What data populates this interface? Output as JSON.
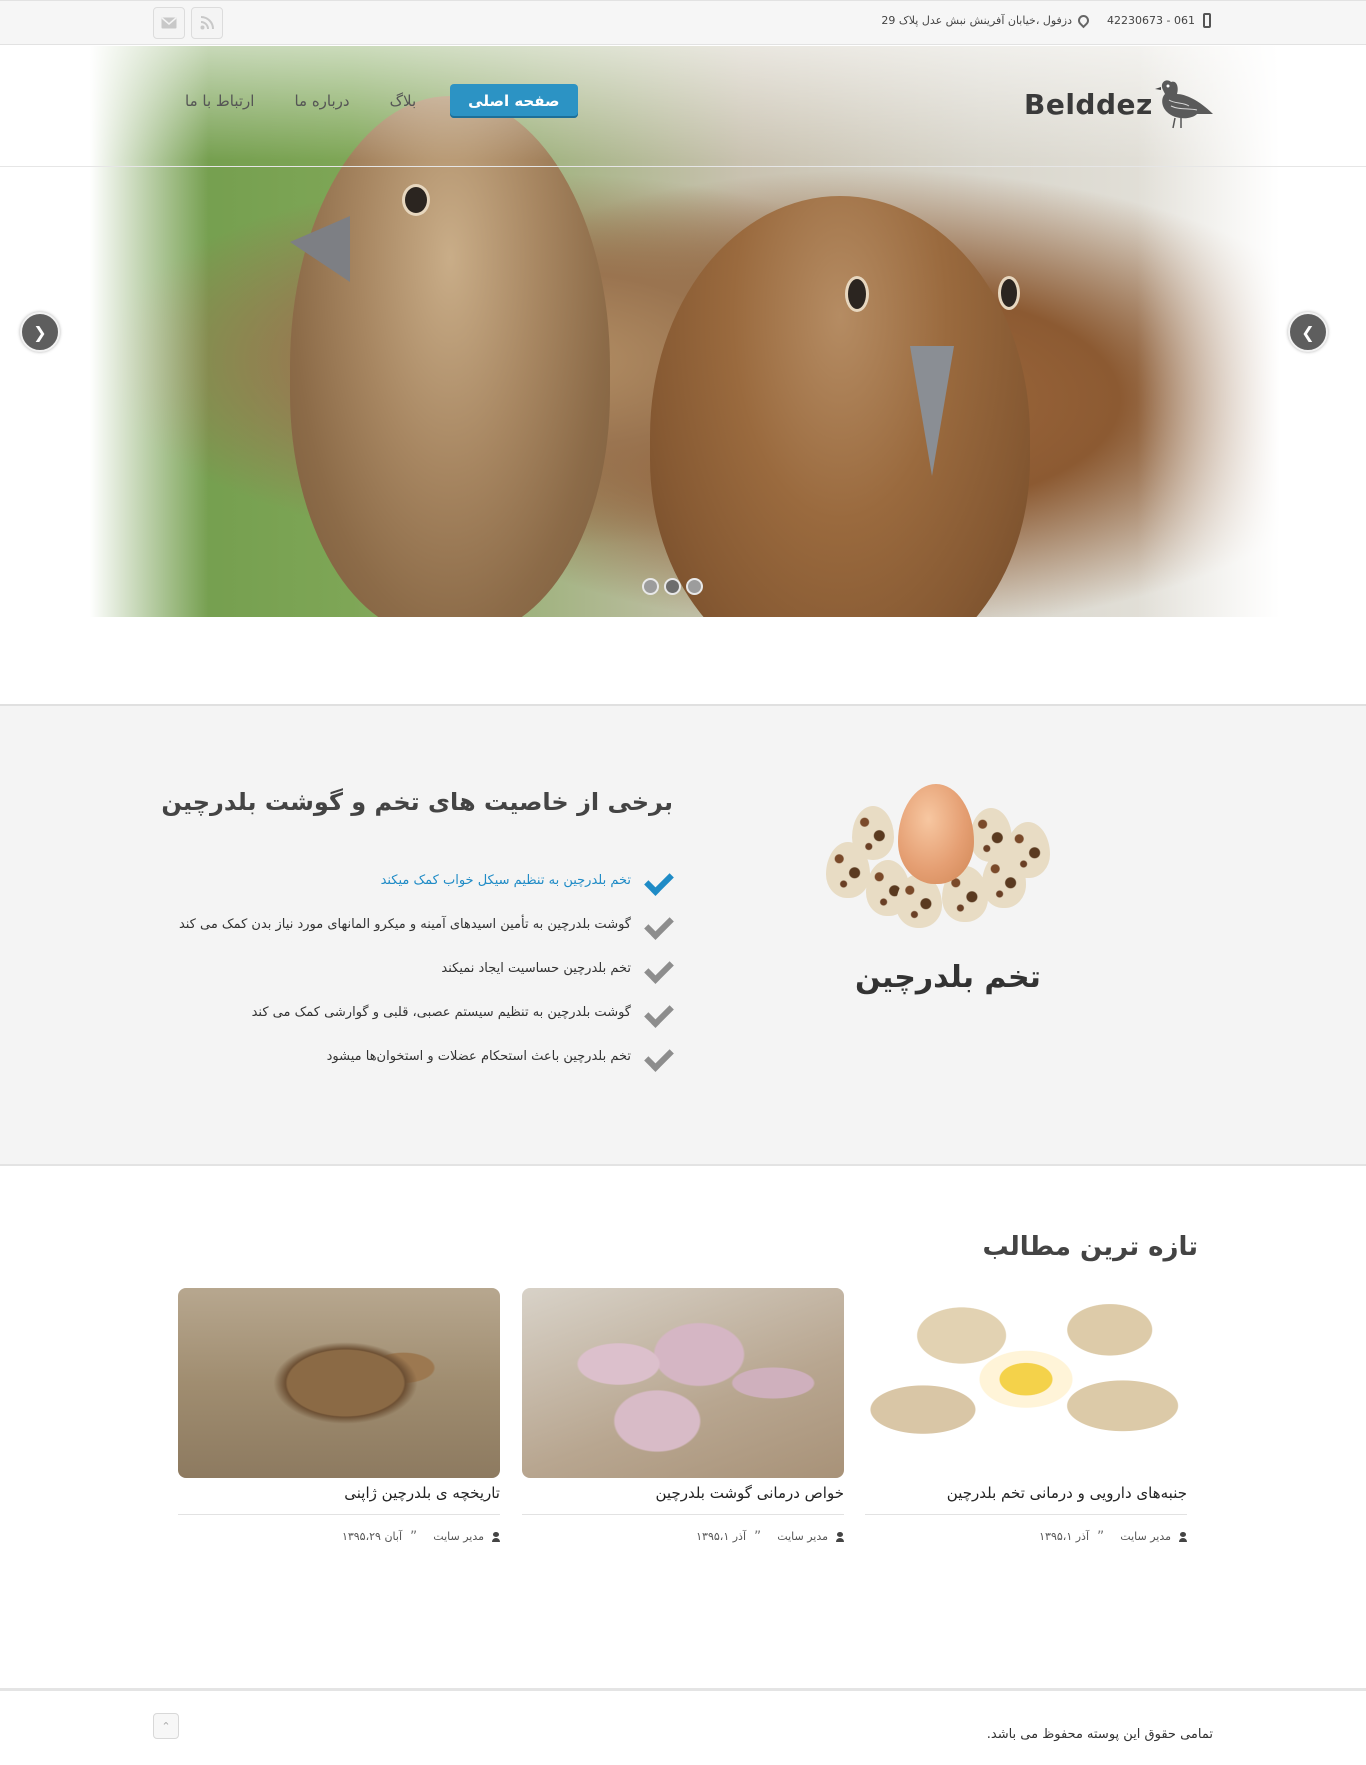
{
  "topbar": {
    "phone": "061 - 42230673",
    "address": "دزفول ،خیابان آفرینش نبش عدل پلاک 29",
    "social": [
      {
        "icon": "rss-icon"
      },
      {
        "icon": "email-icon"
      }
    ]
  },
  "header": {
    "logo_text": "Belddez",
    "nav": [
      {
        "label": "صفحه اصلی",
        "active": true
      },
      {
        "label": "بلاگ",
        "active": false
      },
      {
        "label": "درباره ما",
        "active": false
      },
      {
        "label": "ارتباط با ما",
        "active": false
      }
    ]
  },
  "slider": {
    "prev_icon": "chevron-left-icon",
    "next_icon": "chevron-right-icon",
    "slide_count": 3,
    "active_index": 1
  },
  "features": {
    "title": "برخی از خاصیت های تخم و گوشت بلدرچین",
    "items": [
      {
        "text": "تخم بلدرچین به تنظیم سیکل خواب کمک میکند",
        "highlight": true
      },
      {
        "text": "گوشت بلدرچین به تأمین اسیدهای آمینه و میکرو المانهای مورد نیاز بدن کمک می کند",
        "highlight": false
      },
      {
        "text": "تخم بلدرچین حساسیت ایجاد نمیکند",
        "highlight": false
      },
      {
        "text": "گوشت بلدرچین به تنظیم سیستم عصبی، قلبی و گوارشی کمک می کند",
        "highlight": false
      },
      {
        "text": "تخم بلدرچین باعث استحکام عضلات و استخوان‌ها میشود",
        "highlight": false
      }
    ],
    "image_caption": "تخم بلدرچین"
  },
  "latest": {
    "title": "تازه ترین مطالب",
    "posts": [
      {
        "title": "جنبه‌های دارویی و درمانی تخم بلدرچین",
        "author": "مدیر سایت",
        "date": "آذر ۱۳۹۵،۱"
      },
      {
        "title": "خواص درمانی گوشت بلدرچین",
        "author": "مدیر سایت",
        "date": "آذر ۱۳۹۵،۱"
      },
      {
        "title": "تاریخچه ی بلدرچین ژاپنی",
        "author": "مدیر سایت",
        "date": "آبان ۱۳۹۵،۲۹"
      }
    ]
  },
  "footer": {
    "copyright": "تمامی حقوق این پوسته محفوظ می باشد.",
    "to_top_icon": "chevron-up-icon"
  },
  "colors": {
    "accent": "#2c93c4",
    "highlight_text": "#1f8bc6",
    "section_bg": "#f4f4f4"
  }
}
